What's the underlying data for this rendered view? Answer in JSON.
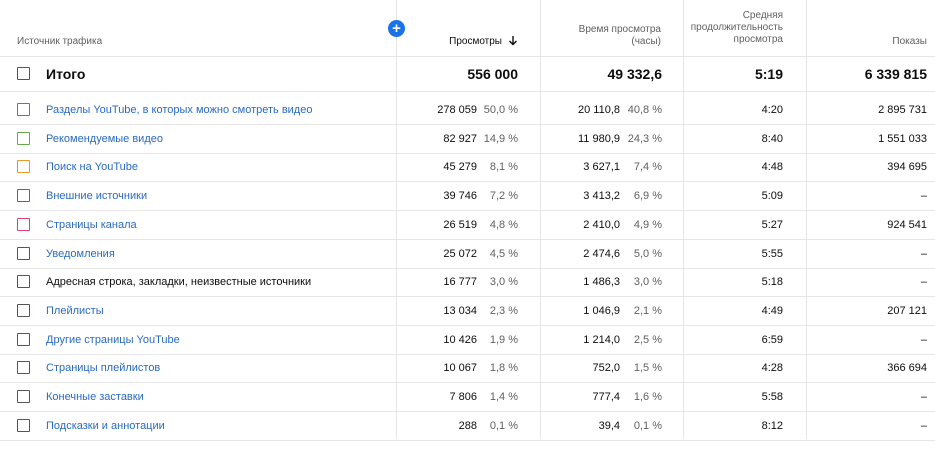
{
  "header": {
    "source": "Источник трафика",
    "views": "Просмотры",
    "views_sort_icon": "arrow-down-icon",
    "watch_time_line1": "Время просмотра",
    "watch_time_line2": "(часы)",
    "avg_line1": "Средняя",
    "avg_line2": "продолжительность",
    "avg_line3": "просмотра",
    "impressions": "Показы",
    "add_metric_icon": "plus-circle-icon"
  },
  "total": {
    "label": "Итого",
    "views": "556 000",
    "watch_time": "49 332,6",
    "avg": "5:19",
    "impressions": "6 339 815"
  },
  "rows": [
    {
      "label": "Разделы YouTube, в которых можно смотреть видео",
      "color": "#3b82c4",
      "link": true,
      "views": "278 059",
      "views_pct": "50,0 %",
      "wt": "20 110,8",
      "wt_pct": "40,8 %",
      "avg": "4:20",
      "imp": "2 895 731"
    },
    {
      "label": "Рекомендуемые видео",
      "color": "#6aa84f",
      "link": true,
      "views": "82 927",
      "views_pct": "14,9 %",
      "wt": "11 980,9",
      "wt_pct": "24,3 %",
      "avg": "8:40",
      "imp": "1 551 033"
    },
    {
      "label": "Поиск на YouTube",
      "color": "#e69a28",
      "link": true,
      "views": "45 279",
      "views_pct": "8,1 %",
      "wt": "3 627,1",
      "wt_pct": "7,4 %",
      "avg": "4:48",
      "imp": "394 695"
    },
    {
      "label": "Внешние источники",
      "color": "#8e44ad",
      "link": true,
      "views": "39 746",
      "views_pct": "7,2 %",
      "wt": "3 413,2",
      "wt_pct": "6,9 %",
      "avg": "5:09",
      "imp": "–"
    },
    {
      "label": "Страницы канала",
      "color": "#d6457a",
      "link": true,
      "views": "26 519",
      "views_pct": "4,8 %",
      "wt": "2 410,0",
      "wt_pct": "4,9 %",
      "avg": "5:27",
      "imp": "924 541"
    },
    {
      "label": "Уведомления",
      "color": "#555555",
      "link": true,
      "views": "25 072",
      "views_pct": "4,5 %",
      "wt": "2 474,6",
      "wt_pct": "5,0 %",
      "avg": "5:55",
      "imp": "–"
    },
    {
      "label": "Адресная строка, закладки, неизвестные источники",
      "color": "#555555",
      "link": false,
      "views": "16 777",
      "views_pct": "3,0 %",
      "wt": "1 486,3",
      "wt_pct": "3,0 %",
      "avg": "5:18",
      "imp": "–"
    },
    {
      "label": "Плейлисты",
      "color": "#555555",
      "link": true,
      "views": "13 034",
      "views_pct": "2,3 %",
      "wt": "1 046,9",
      "wt_pct": "2,1 %",
      "avg": "4:49",
      "imp": "207 121"
    },
    {
      "label": "Другие страницы YouTube",
      "color": "#555555",
      "link": true,
      "views": "10 426",
      "views_pct": "1,9 %",
      "wt": "1 214,0",
      "wt_pct": "2,5 %",
      "avg": "6:59",
      "imp": "–"
    },
    {
      "label": "Страницы плейлистов",
      "color": "#555555",
      "link": true,
      "views": "10 067",
      "views_pct": "1,8 %",
      "wt": "752,0",
      "wt_pct": "1,5 %",
      "avg": "4:28",
      "imp": "366 694"
    },
    {
      "label": "Конечные заставки",
      "color": "#555555",
      "link": true,
      "views": "7 806",
      "views_pct": "1,4 %",
      "wt": "777,4",
      "wt_pct": "1,6 %",
      "avg": "5:58",
      "imp": "–"
    },
    {
      "label": "Подсказки и аннотации",
      "color": "#555555",
      "link": true,
      "views": "288",
      "views_pct": "0,1 %",
      "wt": "39,4",
      "wt_pct": "0,1 %",
      "avg": "8:12",
      "imp": "–"
    }
  ]
}
